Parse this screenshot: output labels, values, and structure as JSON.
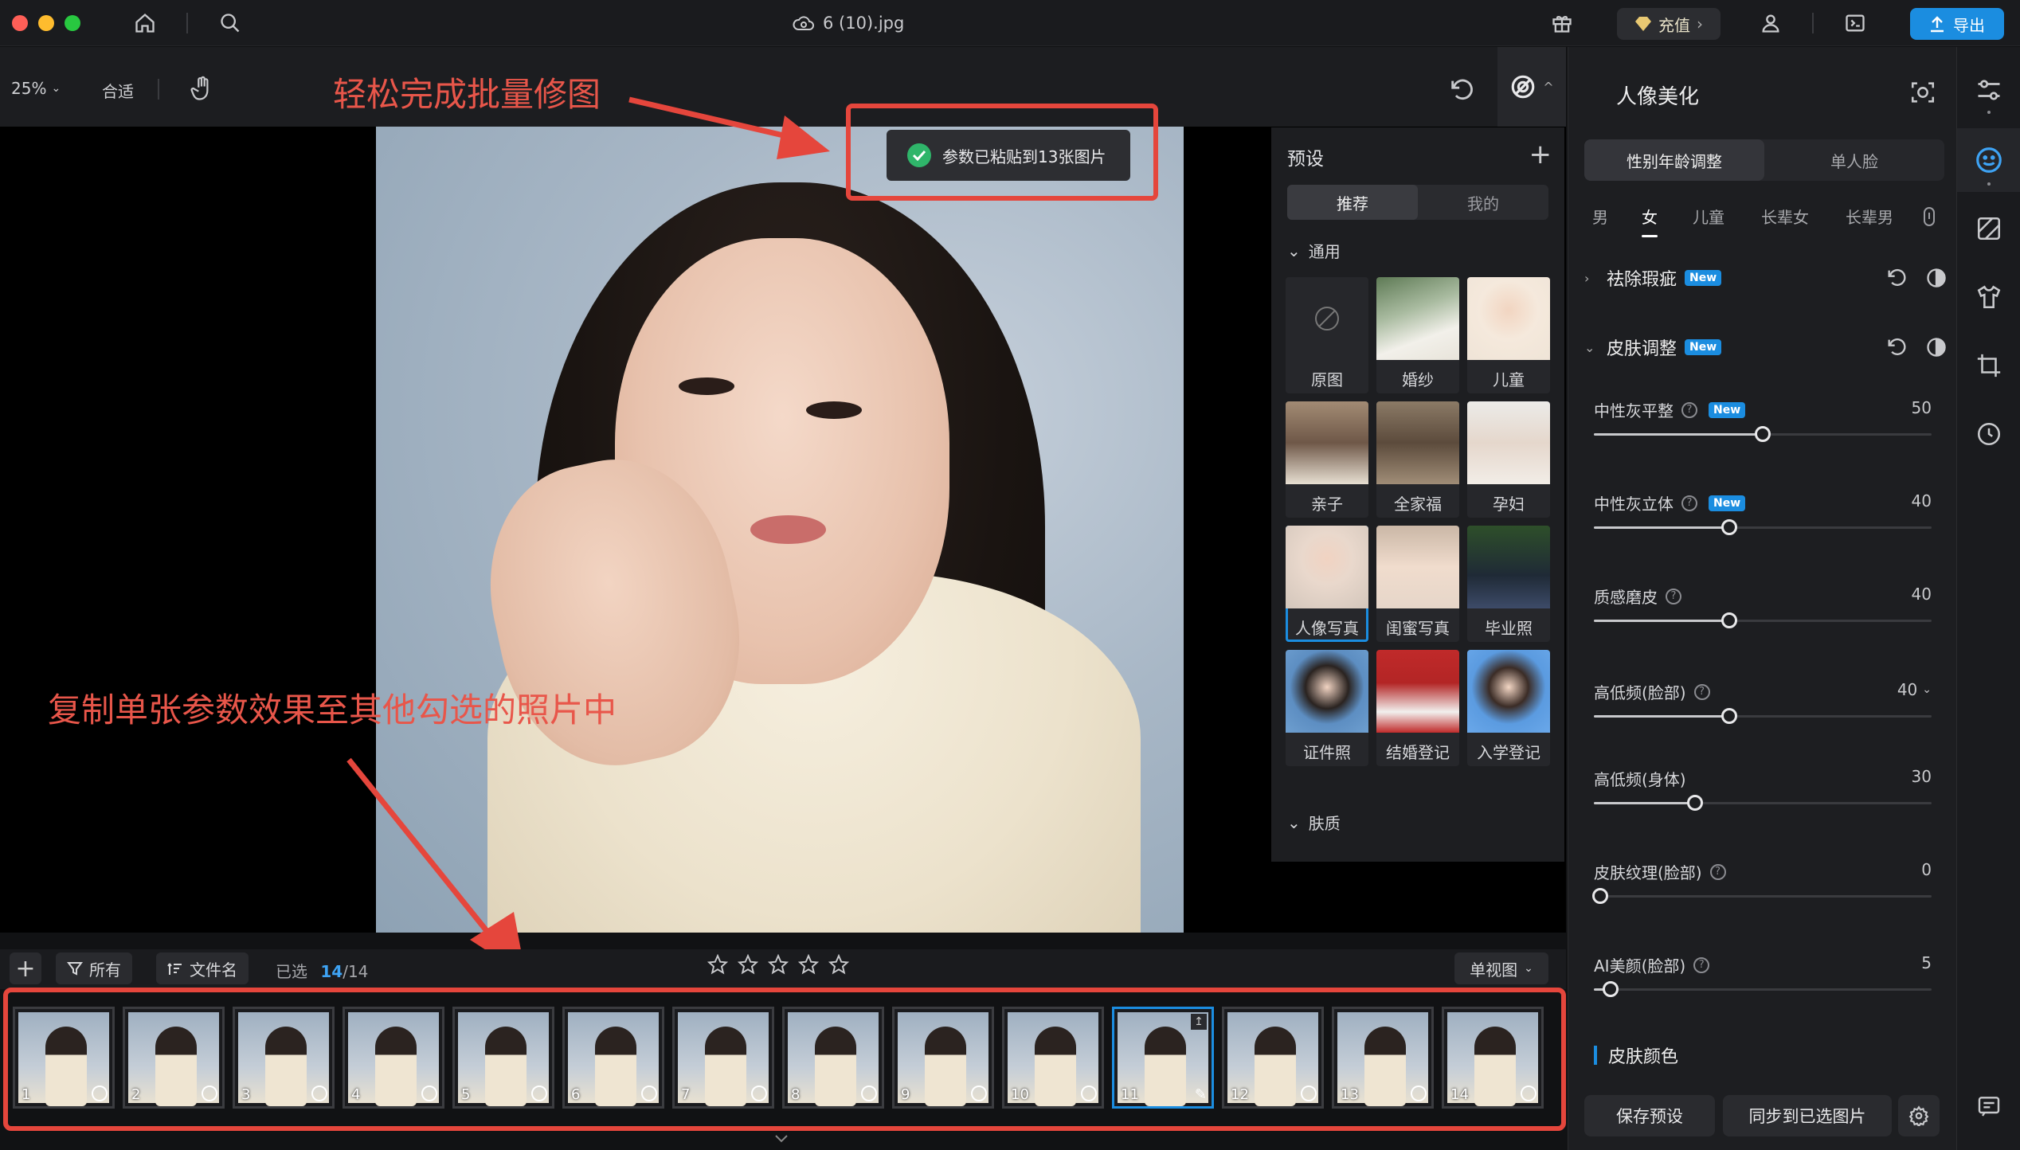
{
  "titlebar": {
    "file_name": "6 (10).jpg",
    "recharge_label": "充值",
    "export_label": "导出"
  },
  "toolbar": {
    "zoom": "25%",
    "fit_label": "合适"
  },
  "toast": {
    "message": "参数已粘贴到13张图片"
  },
  "annotations": {
    "top": "轻松完成批量修图",
    "bottom": "复制单张参数效果至其他勾选的照片中"
  },
  "presets": {
    "title": "预设",
    "tabs": [
      "推荐",
      "我的"
    ],
    "section_general": "通用",
    "section_skin": "肤质",
    "items": [
      {
        "label": "原图"
      },
      {
        "label": "婚纱"
      },
      {
        "label": "儿童"
      },
      {
        "label": "亲子"
      },
      {
        "label": "全家福"
      },
      {
        "label": "孕妇"
      },
      {
        "label": "人像写真"
      },
      {
        "label": "闺蜜写真"
      },
      {
        "label": "毕业照"
      },
      {
        "label": "证件照"
      },
      {
        "label": "结婚登记"
      },
      {
        "label": "入学登记"
      }
    ]
  },
  "filmbar": {
    "filter_label": "所有",
    "sort_label": "文件名",
    "selected_label": "已选",
    "selected_count": "14",
    "total_count": "/14",
    "view_label": "单视图"
  },
  "filmstrip": {
    "thumbnails": [
      "1",
      "2",
      "3",
      "4",
      "5",
      "6",
      "7",
      "8",
      "9",
      "10",
      "11",
      "12",
      "13",
      "14"
    ],
    "current": "11"
  },
  "right_panel": {
    "title": "人像美化",
    "tabs": [
      "性别年龄调整",
      "单人脸"
    ],
    "genders": [
      "男",
      "女",
      "儿童",
      "长辈女",
      "长辈男"
    ],
    "active_gender": "女",
    "sections": {
      "blemish": "祛除瑕疵",
      "skin": "皮肤调整",
      "skin_color": "皮肤颜色"
    },
    "new_badge": "New",
    "sliders": [
      {
        "label": "中性灰平整",
        "value": "50",
        "fraction": 0.5
      },
      {
        "label": "中性灰立体",
        "value": "40",
        "fraction": 0.4
      },
      {
        "label": "质感磨皮",
        "value": "40",
        "fraction": 0.4
      },
      {
        "label": "高低频(脸部)",
        "value": "40",
        "fraction": 0.4
      },
      {
        "label": "高低频(身体)",
        "value": "30",
        "fraction": 0.3
      },
      {
        "label": "皮肤纹理(脸部)",
        "value": "0",
        "fraction": 0.0
      },
      {
        "label": "AI美颜(脸部)",
        "value": "5",
        "fraction": 0.05
      }
    ],
    "save_preset_label": "保存预设",
    "sync_label": "同步到已选图片"
  },
  "colors": {
    "accent": "#1b8de0",
    "annotation": "#e5463c",
    "background": "#111214"
  }
}
